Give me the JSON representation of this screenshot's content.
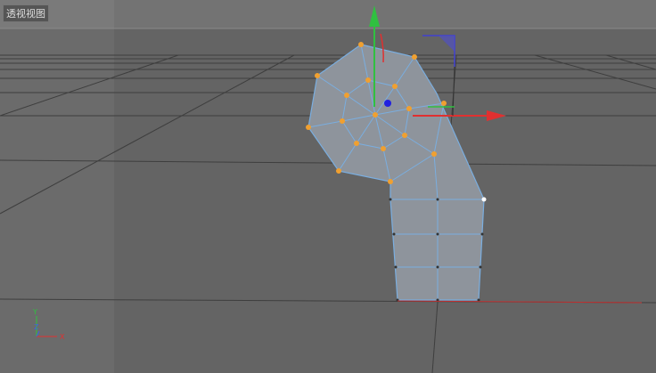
{
  "viewport": {
    "label": "透视视图"
  },
  "axis_indicator": {
    "y_label": "Y",
    "z_label": "Z",
    "x_label": "X"
  },
  "colors": {
    "x_axis": "#e03030",
    "y_axis": "#30c040",
    "z_axis": "#3030e0",
    "mesh_edge": "#7aaee0",
    "point": "#f0a030",
    "mesh_fill": "#8e949c"
  }
}
